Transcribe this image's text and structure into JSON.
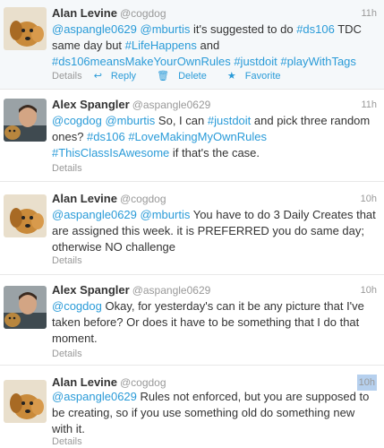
{
  "tweets": [
    {
      "name": "Alan Levine",
      "handle": "@cogdog",
      "time": "11h",
      "segments": [
        {
          "t": "@aspangle0629",
          "link": true
        },
        {
          "t": " ",
          "link": false
        },
        {
          "t": "@mburtis",
          "link": true
        },
        {
          "t": " it's suggested to do ",
          "link": false
        },
        {
          "t": "#ds106",
          "link": true
        },
        {
          "t": " TDC same day but ",
          "link": false
        },
        {
          "t": "#LifeHappens",
          "link": true
        },
        {
          "t": " and ",
          "link": false
        },
        {
          "t": "#ds106meansMakeYourOwnRules",
          "link": true
        },
        {
          "t": " ",
          "link": false
        },
        {
          "t": "#justdoit",
          "link": true
        },
        {
          "t": " ",
          "link": false
        },
        {
          "t": "#playWithTags",
          "link": true
        }
      ],
      "details": "Details",
      "reply": "Reply",
      "delete": "Delete",
      "favorite": "Favorite"
    },
    {
      "name": "Alex Spangler",
      "handle": "@aspangle0629",
      "time": "11h",
      "segments": [
        {
          "t": "@cogdog",
          "link": true
        },
        {
          "t": " ",
          "link": false
        },
        {
          "t": "@mburtis",
          "link": true
        },
        {
          "t": " So, I can ",
          "link": false
        },
        {
          "t": "#justdoit",
          "link": true
        },
        {
          "t": " and pick three random ones? ",
          "link": false
        },
        {
          "t": "#ds106",
          "link": true
        },
        {
          "t": " ",
          "link": false
        },
        {
          "t": "#LoveMakingMyOwnRules",
          "link": true
        },
        {
          "t": " ",
          "link": false
        },
        {
          "t": "#ThisClassIsAwesome",
          "link": true
        },
        {
          "t": " if that's the case.",
          "link": false
        }
      ],
      "details": "Details"
    },
    {
      "name": "Alan Levine",
      "handle": "@cogdog",
      "time": "10h",
      "segments": [
        {
          "t": "@aspangle0629",
          "link": true
        },
        {
          "t": " ",
          "link": false
        },
        {
          "t": "@mburtis",
          "link": true
        },
        {
          "t": " You have to do 3 Daily Creates that are assigned this week. it is PREFERRED you do same day; otherwise NO challenge",
          "link": false
        }
      ],
      "details": "Details"
    },
    {
      "name": "Alex Spangler",
      "handle": "@aspangle0629",
      "time": "10h",
      "segments": [
        {
          "t": "@cogdog",
          "link": true
        },
        {
          "t": " Okay, for yesterday's can it be any picture that I've taken before? Or does it have to be something that I do that moment.",
          "link": false
        }
      ],
      "details": "Details"
    },
    {
      "name": "Alan Levine",
      "handle": "@cogdog",
      "time": "10h",
      "segments": [
        {
          "t": "@aspangle0629",
          "link": true
        },
        {
          "t": " Rules not enforced, but you are supposed to be creating, so if you use something old do something new with it.",
          "link": false
        }
      ],
      "details": "Details"
    }
  ],
  "colors": {
    "link": "#2a9bd8",
    "muted": "#999999",
    "selected_bg": "#f5f8fa",
    "time_highlight": "#b6d0ee"
  },
  "icons": [
    "dog-avatar",
    "person-avatar",
    "reply-icon",
    "delete-icon",
    "favorite-icon"
  ]
}
